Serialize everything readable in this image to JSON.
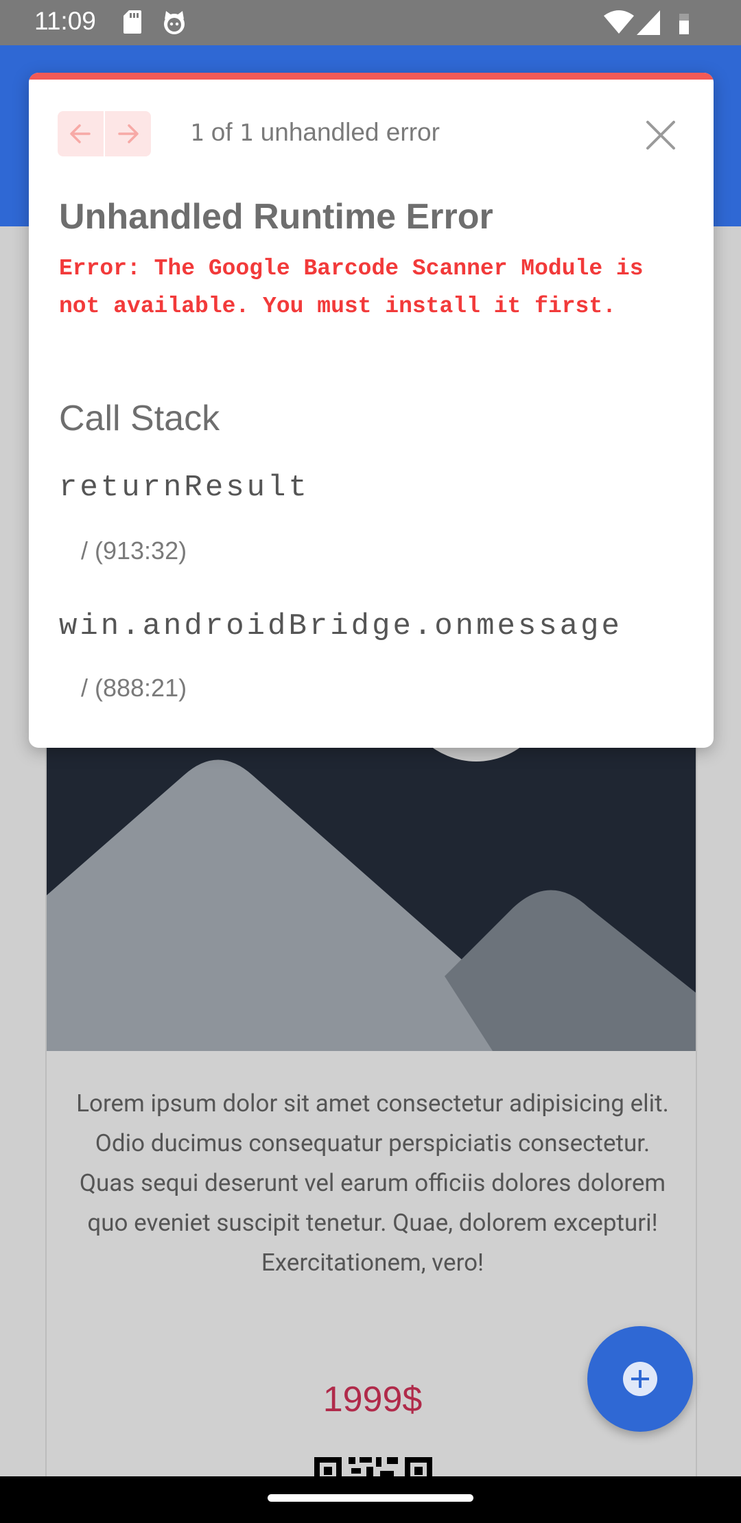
{
  "status_bar": {
    "time": "11:09",
    "icons": [
      "sd-card-icon",
      "cat-icon",
      "wifi-icon",
      "signal-icon",
      "battery-icon"
    ]
  },
  "colors": {
    "app_bar": "#2f68d4",
    "error_accent": "#f25a56",
    "error_text": "#f23a3a",
    "price": "#b02a4a",
    "fab": "#2f68d4"
  },
  "error_dialog": {
    "nav": {
      "prev_icon": "arrow-left-icon",
      "next_icon": "arrow-right-icon"
    },
    "counter": {
      "current": "1",
      "of": "of",
      "total": "1",
      "suffix": "unhandled error"
    },
    "close_icon": "close-icon",
    "title": "Unhandled Runtime Error",
    "message": "Error: The Google Barcode Scanner Module is not available. You must install it first.",
    "call_stack_title": "Call Stack",
    "frames": [
      {
        "function": "returnResult",
        "location": "/ (913:32)"
      },
      {
        "function": "win.androidBridge.onmessage",
        "location": "/ (888:21)"
      }
    ]
  },
  "card": {
    "image_icon": "image-placeholder-icon",
    "description": "Lorem ipsum dolor sit amet consectetur adipisicing elit. Odio ducimus consequatur perspiciatis consectetur. Quas sequi deserunt vel earum officiis dolores dolorem quo eveniet suscipit tenetur. Quae, dolorem excepturi! Exercitationem, vero!",
    "price": "1999$",
    "qr_icon": "qr-code-icon"
  },
  "fab": {
    "icon": "add-circle-icon"
  }
}
